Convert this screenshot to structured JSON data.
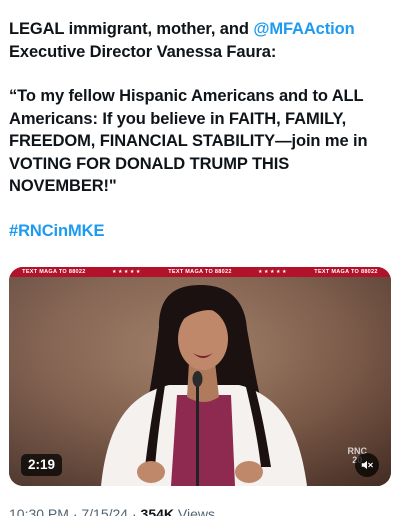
{
  "tweet": {
    "line1_prefix": "LEGAL immigrant, mother, and ",
    "mention": "@MFAAction",
    "line2": "Executive Director Vanessa Faura:",
    "quote": "“To my fellow Hispanic Americans and to ALL Americans: If you believe in FAITH, FAMILY, FREEDOM, FINANCIAL STABILITY—join me in VOTING FOR DONALD TRUMP THIS NOVEMBER!\"",
    "hashtag": "#RNCinMKE"
  },
  "video": {
    "ticker_text": "TEXT MAGA TO 88022",
    "ticker_stars": "★★★★★",
    "duration": "2:19",
    "logo_line1": "RNC",
    "logo_line2": "20",
    "mute_icon": "speaker-muted-icon",
    "colors": {
      "ticker": "#b3122b",
      "background": "#6b4a3a",
      "blazer": "#f4f1ee",
      "top": "#8e2a4f",
      "hair": "#1b1110"
    }
  },
  "meta": {
    "time": "10:30 PM · 7/15/24",
    "views_count": "354K",
    "views_label": "Views"
  }
}
